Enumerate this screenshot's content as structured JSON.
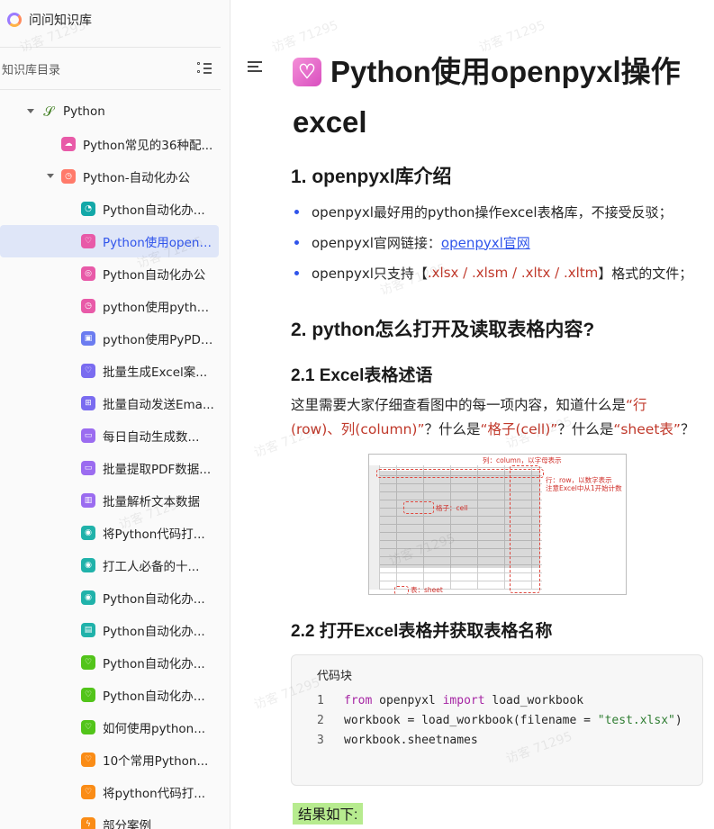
{
  "app": {
    "title": "问问知识库"
  },
  "sidebar": {
    "dir_title": "知识库目录",
    "root": {
      "label": "Python",
      "icon": "snake-icon"
    },
    "group": {
      "label": "Python-自动化办公",
      "icon": "clock-icon"
    },
    "top_item": {
      "label": "Python常见的36种配...",
      "icon": "cloud-icon",
      "color": "#e85aa8"
    },
    "items": [
      {
        "label": "Python自动化办...",
        "icon": "gauge-icon",
        "color": "#13a8a8"
      },
      {
        "label": "Python使用openp...",
        "icon": "heart-icon",
        "color": "#e85aa8"
      },
      {
        "label": "Python自动化办公",
        "icon": "target-icon",
        "color": "#e85aa8"
      },
      {
        "label": "python使用pytho...",
        "icon": "clock-icon",
        "color": "#e85aa8"
      },
      {
        "label": "python使用PyPDF...",
        "icon": "gamepad-icon",
        "color": "#6b7cf0"
      },
      {
        "label": "批量生成Excel案...",
        "icon": "heart-icon",
        "color": "#7a6cf0"
      },
      {
        "label": "批量自动发送Ema...",
        "icon": "grid-icon",
        "color": "#7a6cf0"
      },
      {
        "label": "每日自动生成数...",
        "icon": "note-icon",
        "color": "#9b6cf0"
      },
      {
        "label": "批量提取PDF数据...",
        "icon": "note-icon",
        "color": "#9b6cf0"
      },
      {
        "label": "批量解析文本数据",
        "icon": "chart-icon",
        "color": "#9b6cf0"
      },
      {
        "label": "将Python代码打...",
        "icon": "compass-icon",
        "color": "#20b2aa"
      },
      {
        "label": "打工人必备的十...",
        "icon": "compass-icon",
        "color": "#20b2aa"
      },
      {
        "label": "Python自动化办...",
        "icon": "compass-icon",
        "color": "#20b2aa"
      },
      {
        "label": "Python自动化办...",
        "icon": "calendar-icon",
        "color": "#20b2aa"
      },
      {
        "label": "Python自动化办...",
        "icon": "heart-icon",
        "color": "#52c41a"
      },
      {
        "label": "Python自动化办...",
        "icon": "heart-icon",
        "color": "#52c41a"
      },
      {
        "label": "如何使用python...",
        "icon": "heart-icon",
        "color": "#52c41a"
      },
      {
        "label": "10个常用Python...",
        "icon": "heart-icon",
        "color": "#fa8c16"
      },
      {
        "label": "将python代码打...",
        "icon": "heart-icon",
        "color": "#fa8c16"
      },
      {
        "label": "部分案例",
        "icon": "bolt-icon",
        "color": "#fa8c16"
      }
    ],
    "active_index": 1
  },
  "doc": {
    "title": "Python使用openpyxl操作excel",
    "h1": "1. openpyxl库介绍",
    "bullets": {
      "b1": "openpyxl最好用的python操作excel表格库，不接受反驳；",
      "b2_prefix": "openpyxl官网链接：",
      "b2_link": "openpyxl官网",
      "b3_prefix": "openpyxl只支持【",
      "b3_formats": ".xlsx / .xlsm / .xltx / .xltm",
      "b3_suffix": "】格式的文件；"
    },
    "h2": "2. python怎么打开及读取表格内容?",
    "h2_1": "2.1 Excel表格述语",
    "para": {
      "p1": "这里需要大家仔细查看图中的每一项内容，知道什么是",
      "p2": "“行(row)、列(column)”",
      "p3": "？什么是",
      "p4": "“格子(cell)”",
      "p5": "？什么是",
      "p6": "“sheet表”",
      "p7": "？"
    },
    "figure": {
      "col_note": "列：column，以字母表示",
      "row_note": "行：row，以数字表示",
      "row_note2": "注意Excel中从1开始计数",
      "cell_note": "格子：cell",
      "sheet_note": "表：sheet"
    },
    "h2_2": "2.2 打开Excel表格并获取表格名称",
    "code": {
      "label": "代码块",
      "lines": [
        {
          "n": "1",
          "kw1": "from",
          "t1": " openpyxl ",
          "kw2": "import",
          "t2": " load_workbook"
        },
        {
          "n": "2",
          "t1": "workbook = load_workbook(filename = ",
          "s": "\"test.xlsx\"",
          "t2": ")"
        },
        {
          "n": "3",
          "t1": "workbook.sheetnames"
        }
      ]
    },
    "result": "结果如下:"
  },
  "watermark": "访客 71295"
}
